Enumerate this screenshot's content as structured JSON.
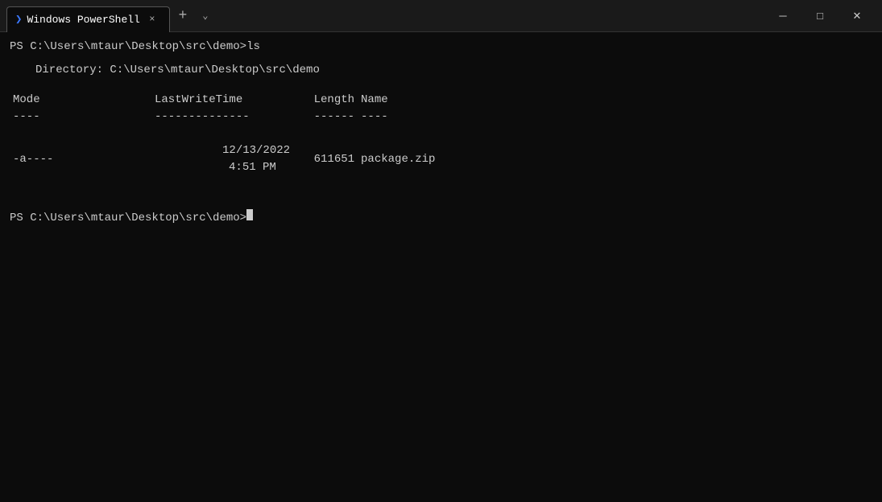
{
  "titlebar": {
    "tab_label": "Windows PowerShell",
    "tab_icon": "❯",
    "close_label": "×",
    "new_tab_label": "+",
    "dropdown_label": "⌄"
  },
  "window_controls": {
    "minimize_label": "─",
    "maximize_label": "□",
    "close_label": "✕"
  },
  "terminal": {
    "prompt1": "PS C:\\Users\\mtaur\\Desktop\\src\\demo>",
    "cmd1": " ls",
    "dir_label": "Directory:",
    "dir_path": "C:\\Users\\mtaur\\Desktop\\src\\demo",
    "col_mode": "Mode",
    "col_lwt": "LastWriteTime",
    "col_len": "Length",
    "col_name": "Name",
    "sep_mode": "----",
    "sep_lwt": "--------------",
    "sep_len": "------",
    "sep_name": "----",
    "file_mode": "-a----",
    "file_date": "12/13/2022",
    "file_time": "4:51 PM",
    "file_size": "611651",
    "file_name": "package.zip",
    "prompt2": "PS C:\\Users\\mtaur\\Desktop\\src\\demo>"
  }
}
